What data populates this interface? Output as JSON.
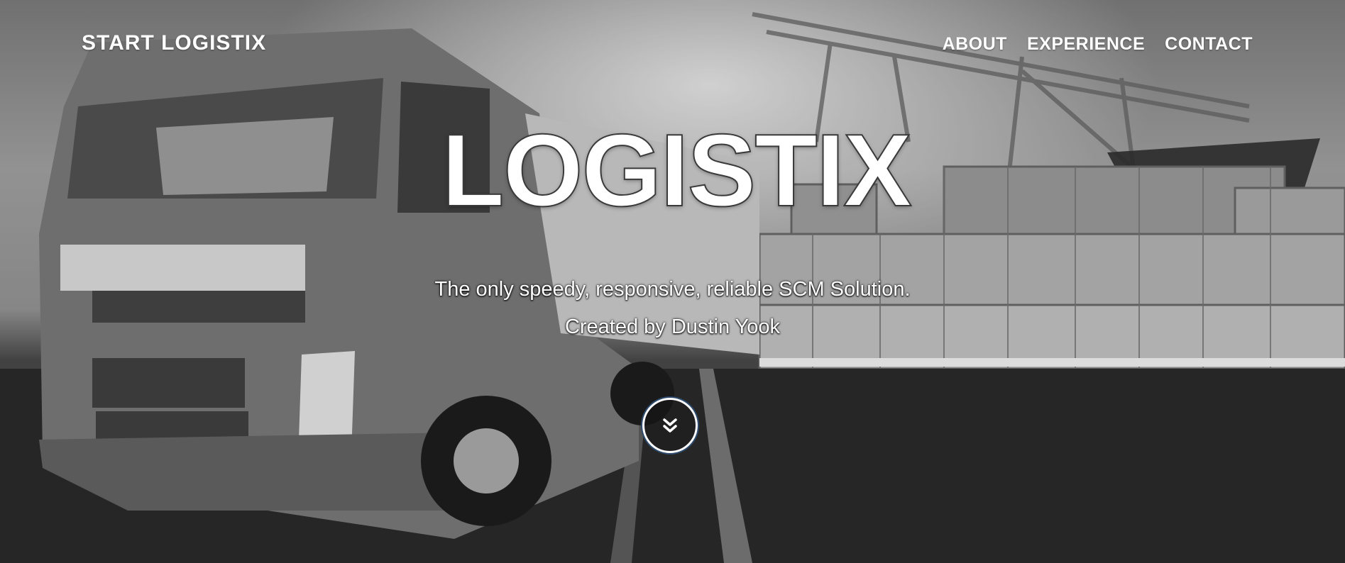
{
  "nav": {
    "brand": "START LOGISTIX",
    "links": [
      {
        "label": "ABOUT"
      },
      {
        "label": "EXPERIENCE"
      },
      {
        "label": "CONTACT"
      }
    ]
  },
  "hero": {
    "title": "LOGISTIX",
    "tagline": "The only speedy, responsive, reliable SCM Solution.",
    "credit": "Created by Dustin Yook",
    "scroll_icon": "double-chevron-down-icon"
  }
}
